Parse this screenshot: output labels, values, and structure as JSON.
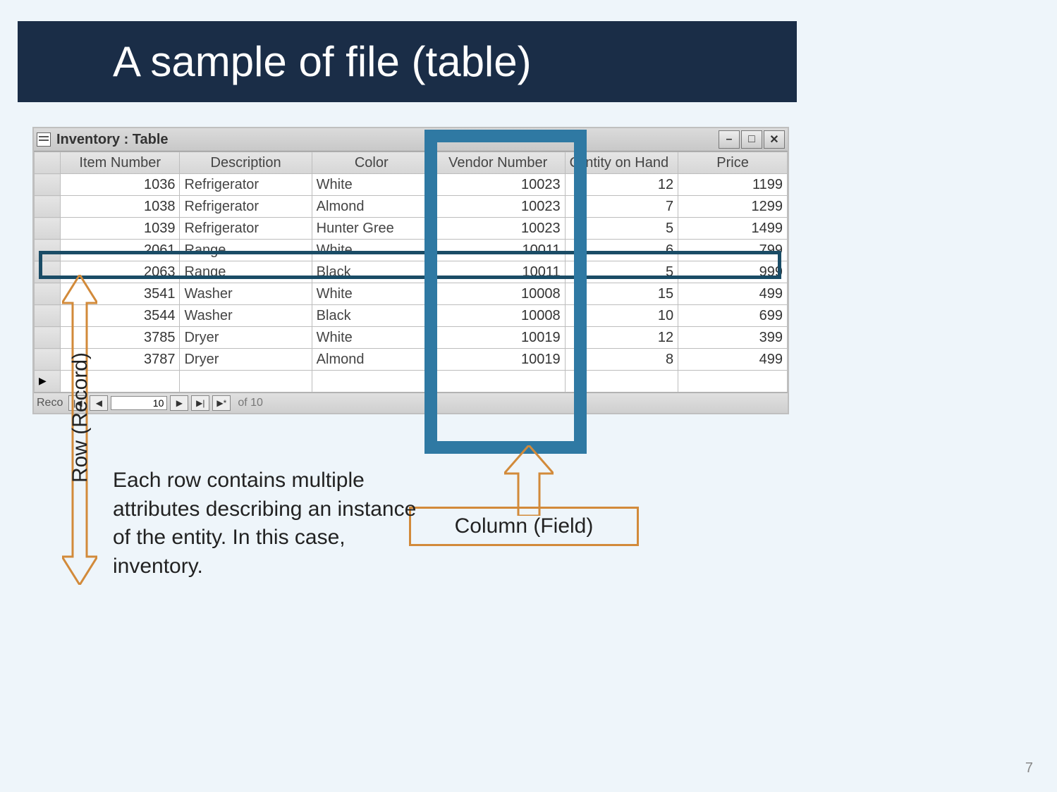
{
  "slide": {
    "title": "A sample of file (table)",
    "page_number": "7"
  },
  "window": {
    "title": "Inventory : Table",
    "nav": {
      "label": "Reco",
      "current": "10",
      "total_label": "of  10"
    }
  },
  "table": {
    "headers": {
      "item": "Item Number",
      "desc": "Description",
      "color": "Color",
      "vendor": "Vendor Number",
      "qty_left": "Q",
      "qty_right": "ntity on Hand",
      "price": "Price"
    },
    "rows": [
      {
        "item": "1036",
        "desc": "Refrigerator",
        "color": "White",
        "vendor": "10023",
        "qty": "12",
        "price": "1199"
      },
      {
        "item": "1038",
        "desc": "Refrigerator",
        "color": "Almond",
        "vendor": "10023",
        "qty": "7",
        "price": "1299"
      },
      {
        "item": "1039",
        "desc": "Refrigerator",
        "color": "Hunter Gree",
        "vendor": "10023",
        "qty": "5",
        "price": "1499"
      },
      {
        "item": "2061",
        "desc": "Range",
        "color": "White",
        "vendor": "10011",
        "qty": "6",
        "price": "799"
      },
      {
        "item": "2063",
        "desc": "Range",
        "color": "Black",
        "vendor": "10011",
        "qty": "5",
        "price": "999"
      },
      {
        "item": "3541",
        "desc": "Washer",
        "color": "White",
        "vendor": "10008",
        "qty": "15",
        "price": "499"
      },
      {
        "item": "3544",
        "desc": "Washer",
        "color": "Black",
        "vendor": "10008",
        "qty": "10",
        "price": "699"
      },
      {
        "item": "3785",
        "desc": "Dryer",
        "color": "White",
        "vendor": "10019",
        "qty": "12",
        "price": "399"
      },
      {
        "item": "3787",
        "desc": "Dryer",
        "color": "Almond",
        "vendor": "10019",
        "qty": "8",
        "price": "499"
      }
    ]
  },
  "annotations": {
    "row_label": "Row (Record)",
    "column_label": "Column (Field)",
    "explain": "Each row contains multiple attributes describing an instance of the entity. In this case, inventory."
  }
}
